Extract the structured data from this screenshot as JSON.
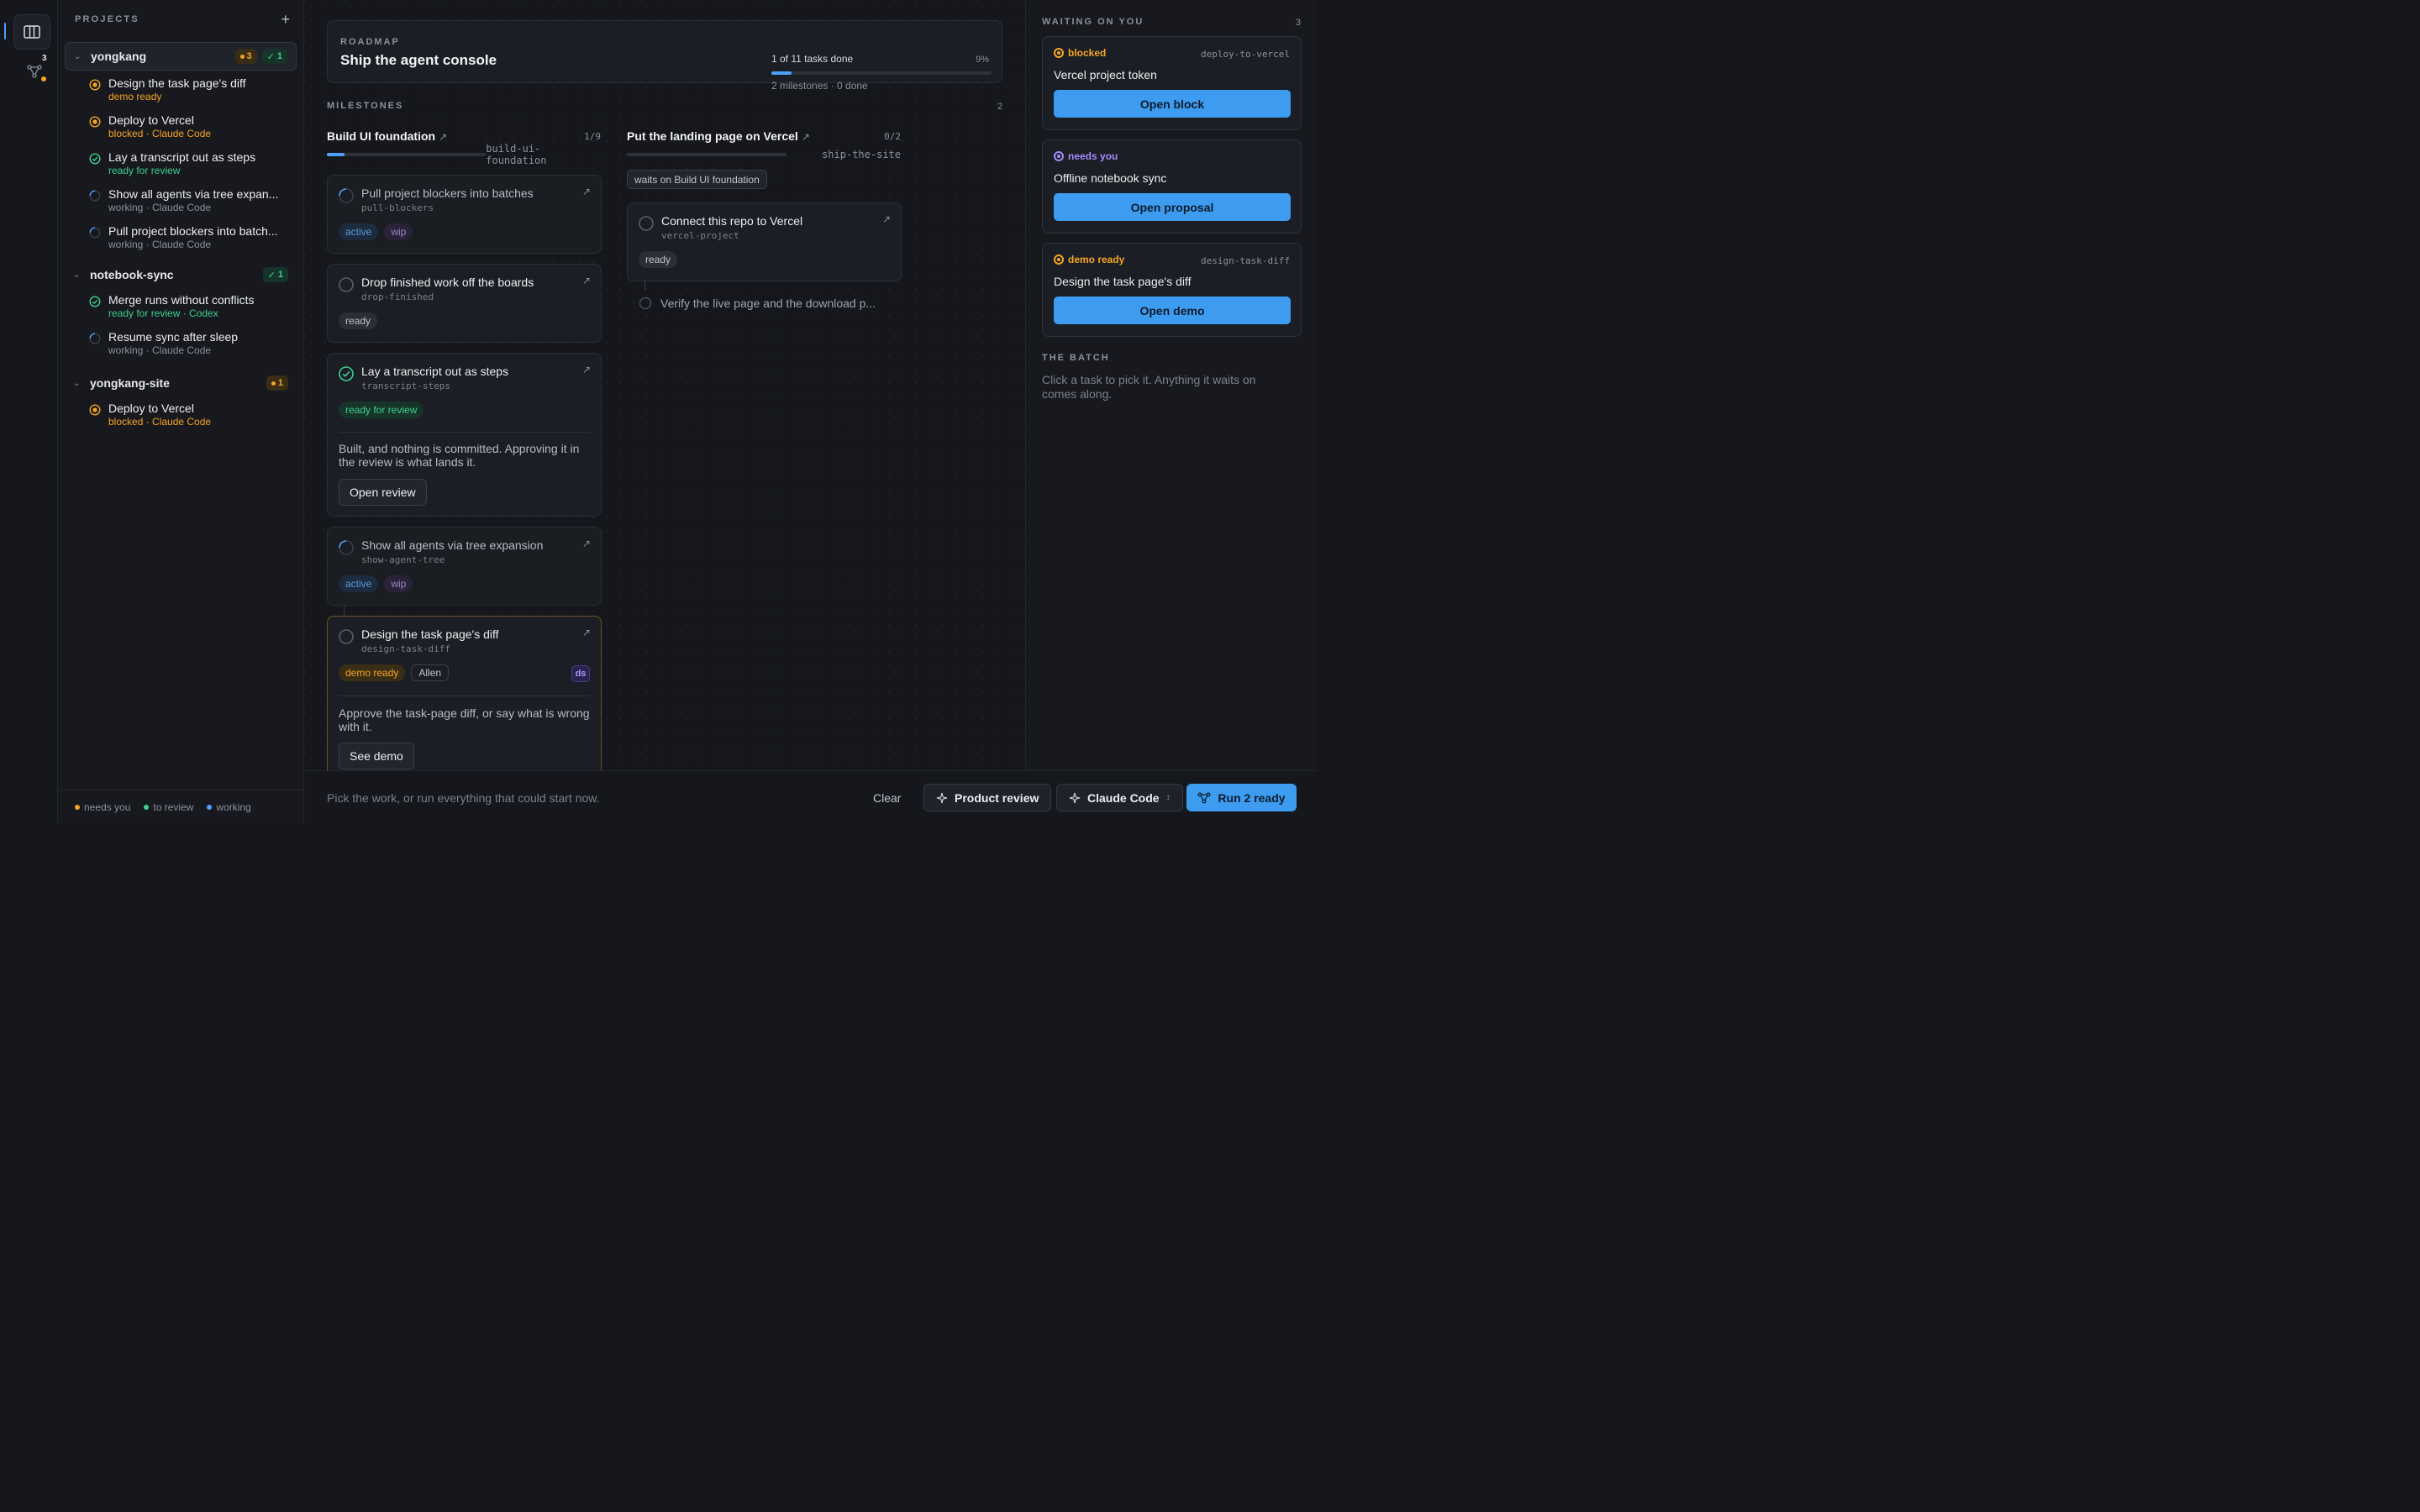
{
  "rail": {
    "graph_count": "3"
  },
  "sidebar": {
    "title": "PROJECTS",
    "add": "+",
    "projects": [
      {
        "name": "yongkang",
        "badges": [
          {
            "type": "warn",
            "text": "3"
          },
          {
            "type": "ok",
            "text": "1"
          }
        ],
        "tasks": [
          {
            "name": "Design the task page's diff",
            "sub": "demo ready",
            "status": "demo"
          },
          {
            "name": "Deploy to Vercel",
            "sub": "blocked · Claude Code",
            "status": "blocked"
          },
          {
            "name": "Lay a transcript out as steps",
            "sub": "ready for review",
            "status": "review"
          },
          {
            "name": "Show all agents via tree expan...",
            "sub": "working · Claude Code",
            "status": "working"
          },
          {
            "name": "Pull project blockers into batch...",
            "sub": "working · Claude Code",
            "status": "working"
          }
        ]
      },
      {
        "name": "notebook-sync",
        "badges": [
          {
            "type": "ok",
            "text": "1"
          }
        ],
        "tasks": [
          {
            "name": "Merge runs without conflicts",
            "sub": "ready for review · Codex",
            "status": "review"
          },
          {
            "name": "Resume sync after sleep",
            "sub": "working · Claude Code",
            "status": "working"
          }
        ]
      },
      {
        "name": "yongkang-site",
        "badges": [
          {
            "type": "warn",
            "text": "1"
          }
        ],
        "tasks": [
          {
            "name": "Deploy to Vercel",
            "sub": "blocked · Claude Code",
            "status": "blocked"
          }
        ]
      }
    ],
    "legend": {
      "needs": "needs you",
      "review": "to review",
      "working": "working"
    }
  },
  "roadmap": {
    "label": "ROADMAP",
    "title": "Ship the agent console",
    "progress_text": "1 of 11 tasks done",
    "percent": "9%",
    "progress": 0.09,
    "summary": "2 milestones · 0 done"
  },
  "milestones": {
    "label": "MILESTONES",
    "count": "2",
    "columns": [
      {
        "title": "Build UI foundation",
        "count": "1/9",
        "slug": "build-ui-foundation",
        "progress": 0.11
      },
      {
        "title": "Put the landing page on Vercel",
        "count": "0/2",
        "slug": "ship-the-site",
        "progress": 0
      }
    ]
  },
  "cards": {
    "pull": {
      "title": "Pull project blockers into batches",
      "slug": "pull-blockers",
      "tags": [
        "active",
        "wip"
      ]
    },
    "drop": {
      "title": "Drop finished work off the boards",
      "slug": "drop-finished",
      "tags": [
        "ready"
      ]
    },
    "transcript": {
      "title": "Lay a transcript out as steps",
      "slug": "transcript-steps",
      "tag": "ready for review",
      "note": "Built, and nothing is committed. Approving it in the review is what lands it.",
      "button": "Open review"
    },
    "agents": {
      "title": "Show all agents via tree expansion",
      "slug": "show-agent-tree",
      "tags": [
        "active",
        "wip"
      ]
    },
    "design": {
      "title": "Design the task page's diff",
      "slug": "design-task-diff",
      "tag": "demo ready",
      "person": "Allen",
      "initials": "ds",
      "note": "Approve the task-page diff, or say what is wrong with it.",
      "button": "See demo"
    },
    "waits_on": "waits on Build UI foundation",
    "vercel": {
      "title": "Connect this repo to Vercel",
      "slug": "vercel-project",
      "tag": "ready"
    },
    "verify": "Verify the live page and the download p..."
  },
  "bottom": {
    "hint": "Pick the work, or run everything that could start now.",
    "clear": "Clear",
    "product_review": "Product review",
    "agent": "Claude Code",
    "run": "Run 2 ready"
  },
  "right": {
    "title": "WAITING ON YOU",
    "count": "3",
    "items": [
      {
        "status": "blocked",
        "slug": "deploy-to-vercel",
        "title": "Vercel project token",
        "button": "Open block"
      },
      {
        "status": "needs you",
        "slug": "",
        "title": "Offline notebook sync",
        "button": "Open proposal"
      },
      {
        "status": "demo ready",
        "slug": "design-task-diff",
        "title": "Design the task page's diff",
        "button": "Open demo"
      }
    ],
    "batch_title": "THE BATCH",
    "batch_text": "Click a task to pick it. Anything it waits on comes along."
  },
  "colors": {
    "accent": "#3d9cf0",
    "orange": "#f5a524",
    "green": "#3ecf8e",
    "purple": "#a78bfa"
  }
}
